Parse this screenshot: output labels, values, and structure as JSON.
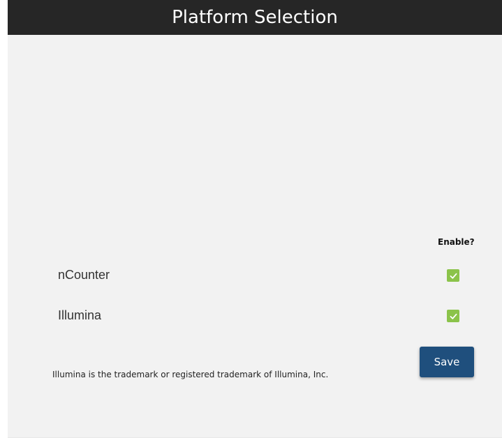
{
  "header": {
    "title": "Platform Selection"
  },
  "table": {
    "enable_column_label": "Enable?",
    "platforms": [
      {
        "name": "nCounter",
        "enabled": true
      },
      {
        "name": "Illumina",
        "enabled": true
      }
    ]
  },
  "footer": {
    "trademark_notice": "Illumina is the trademark or registered trademark of Illumina, Inc.",
    "save_label": "Save"
  },
  "colors": {
    "header_bg": "#262626",
    "panel_bg": "#f2f2f2",
    "checkbox_checked": "#8bc34a",
    "save_button_bg": "#1f4f7d"
  },
  "icons": {
    "checkbox": "check-icon"
  }
}
